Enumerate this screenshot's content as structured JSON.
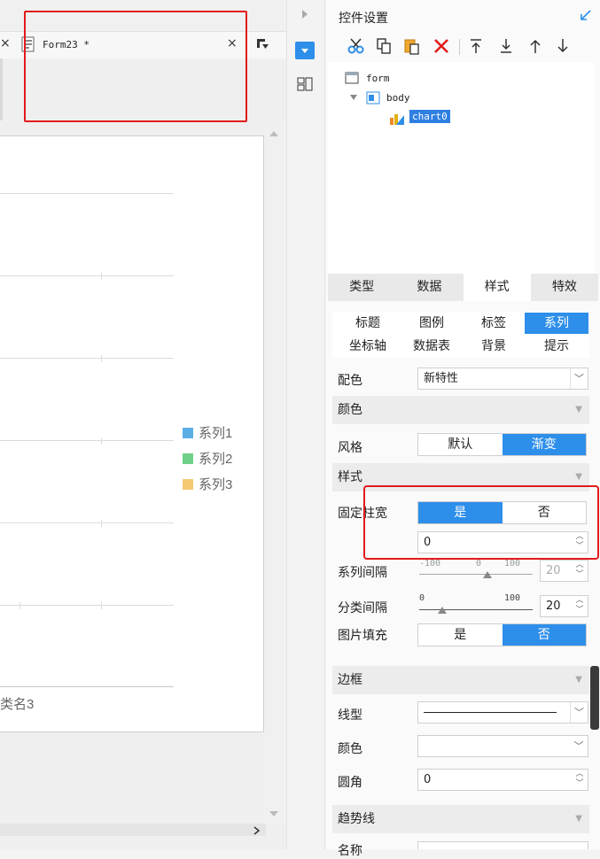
{
  "editor": {
    "tab_title": "Form23 *",
    "close_glyph": "×",
    "chart": {
      "legend": [
        {
          "label": "系列1",
          "color": "#5aaee6"
        },
        {
          "label": "系列2",
          "color": "#6fd08a"
        },
        {
          "label": "系列3",
          "color": "#f5c872"
        }
      ],
      "category_label": "类名3"
    }
  },
  "panel": {
    "title": "控件设置",
    "tree": {
      "root": "form",
      "child": "body",
      "selected": "chart0"
    },
    "main_tabs": [
      "类型",
      "数据",
      "样式",
      "特效"
    ],
    "active_main_tab": "样式",
    "sub_tabs": [
      "标题",
      "图例",
      "标签",
      "系列",
      "坐标轴",
      "数据表",
      "背景",
      "提示"
    ],
    "active_sub_tab": "系列",
    "color_scheme": {
      "label": "配色",
      "value": "新特性"
    },
    "color_section": "颜色",
    "style_row": {
      "label": "风格",
      "options": [
        "默认",
        "渐变"
      ],
      "selected": "渐变"
    },
    "style_section": "样式",
    "fixed_width": {
      "label": "固定柱宽",
      "options": [
        "是",
        "否"
      ],
      "selected": "是",
      "value": "0"
    },
    "series_gap": {
      "label": "系列间隔",
      "min": "-100",
      "mid": "0",
      "max": "100",
      "value": "20"
    },
    "category_gap": {
      "label": "分类间隔",
      "min": "0",
      "max": "100",
      "value": "20"
    },
    "image_fill": {
      "label": "图片填充",
      "options": [
        "是",
        "否"
      ],
      "selected": "否"
    },
    "border_section": "边框",
    "line_type_label": "线型",
    "border_color_label": "颜色",
    "corner_label": "圆角",
    "corner_value": "0",
    "trend_section": "趋势线",
    "name_label": "名称"
  }
}
